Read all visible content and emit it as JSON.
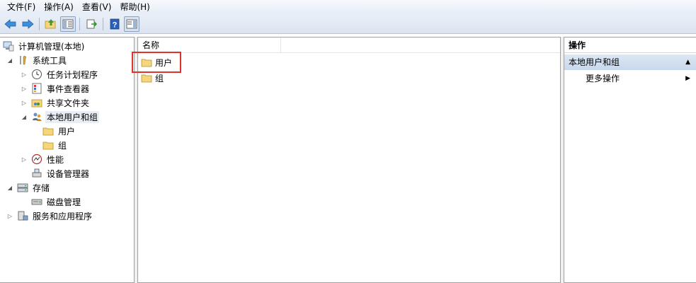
{
  "menu": [
    {
      "label": "文件(F)"
    },
    {
      "label": "操作(A)"
    },
    {
      "label": "查看(V)"
    },
    {
      "label": "帮助(H)"
    }
  ],
  "toolbar": {
    "buttons": [
      "back-icon",
      "forward-icon",
      "up-folder-icon",
      "show-hide-tree-icon",
      "export-list-icon",
      "help-icon",
      "show-hide-action-pane-icon"
    ]
  },
  "tree": {
    "root": "计算机管理(本地)",
    "system_tools": "系统工具",
    "task_scheduler": "任务计划程序",
    "event_viewer": "事件查看器",
    "shared_folders": "共享文件夹",
    "local_users_groups": "本地用户和组",
    "users": "用户",
    "groups": "组",
    "performance": "性能",
    "device_manager": "设备管理器",
    "storage": "存储",
    "disk_management": "磁盘管理",
    "services_apps": "服务和应用程序"
  },
  "list": {
    "column_name": "名称",
    "items": [
      "用户",
      "组"
    ]
  },
  "actions": {
    "title": "操作",
    "section": "本地用户和组",
    "more_actions": "更多操作"
  },
  "colors": {
    "highlight": "#e0322c",
    "folder": "#f5d67b",
    "section_bg": "#c8d8ec"
  }
}
